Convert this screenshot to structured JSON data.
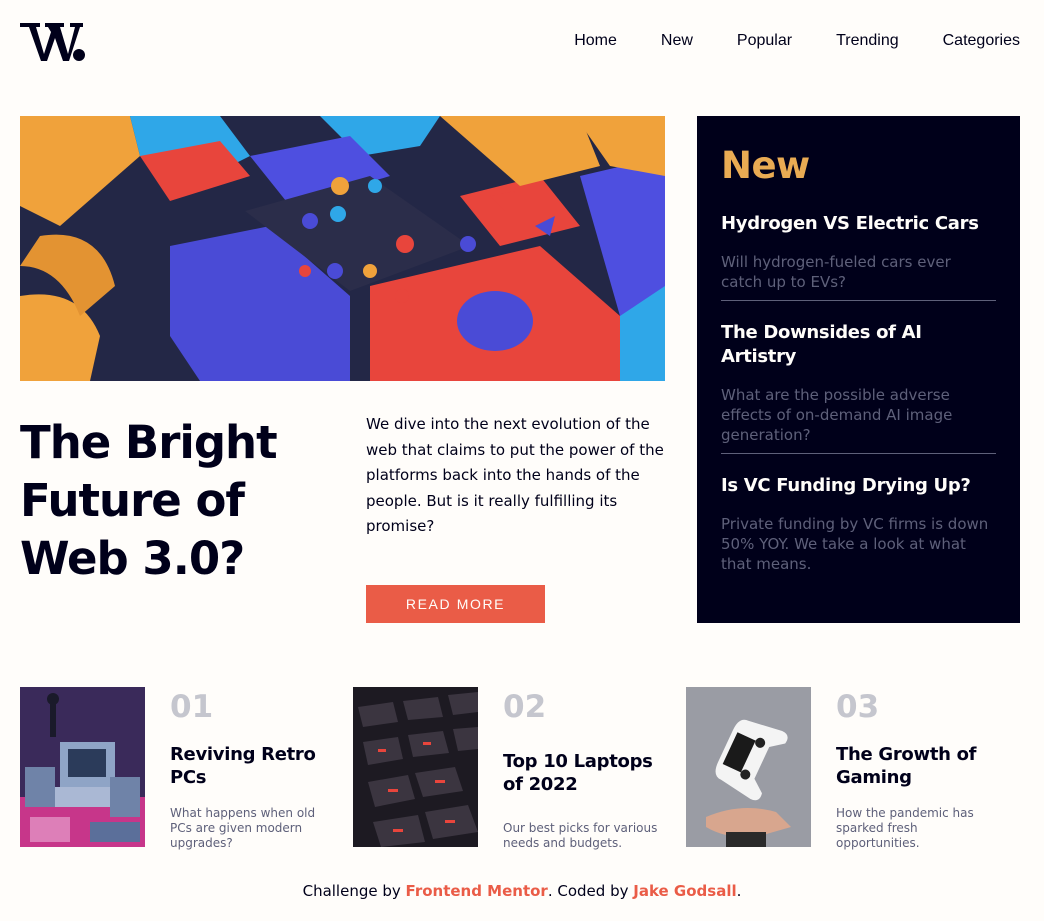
{
  "header": {
    "logo_icon": "w-logo-icon",
    "nav": [
      {
        "label": "Home"
      },
      {
        "label": "New"
      },
      {
        "label": "Popular"
      },
      {
        "label": "Trending"
      },
      {
        "label": "Categories"
      }
    ]
  },
  "hero": {
    "title": "The Bright Future of Web 3.0?",
    "description": "We dive into the next evolution of the web that claims to put the power of the platforms back into the hands of the people. But is it really fulfilling its promise?",
    "button_label": "READ MORE"
  },
  "new_panel": {
    "heading": "New",
    "items": [
      {
        "title": "Hydrogen VS Electric Cars",
        "description": "Will hydrogen-fueled cars ever catch up to EVs?"
      },
      {
        "title": "The Downsides of AI Artistry",
        "description": "What are the possible adverse effects of on-demand AI image generation?"
      },
      {
        "title": "Is VC Funding Drying Up?",
        "description": "Private funding by VC firms is down 50% YOY. We take a look at what that means."
      }
    ]
  },
  "cards": [
    {
      "number": "01",
      "title": "Reviving Retro PCs",
      "description": "What happens when old PCs are given modern upgrades?"
    },
    {
      "number": "02",
      "title": "Top 10 Laptops of 2022",
      "description": "Our best picks for various needs and budgets."
    },
    {
      "number": "03",
      "title": "The Growth of Gaming",
      "description": "How the pandemic has sparked fresh opportunities."
    }
  ],
  "footer": {
    "prefix": "Challenge by ",
    "link1": "Frontend Mentor",
    "middle": ". Coded by ",
    "link2": "Jake Godsall",
    "suffix": "."
  },
  "colors": {
    "background": "#fffdfa",
    "dark": "#00001a",
    "accent_red": "#ea5c47",
    "accent_orange": "#e9ab53",
    "muted": "#5e607a",
    "number_gray": "#c5c6ce"
  }
}
